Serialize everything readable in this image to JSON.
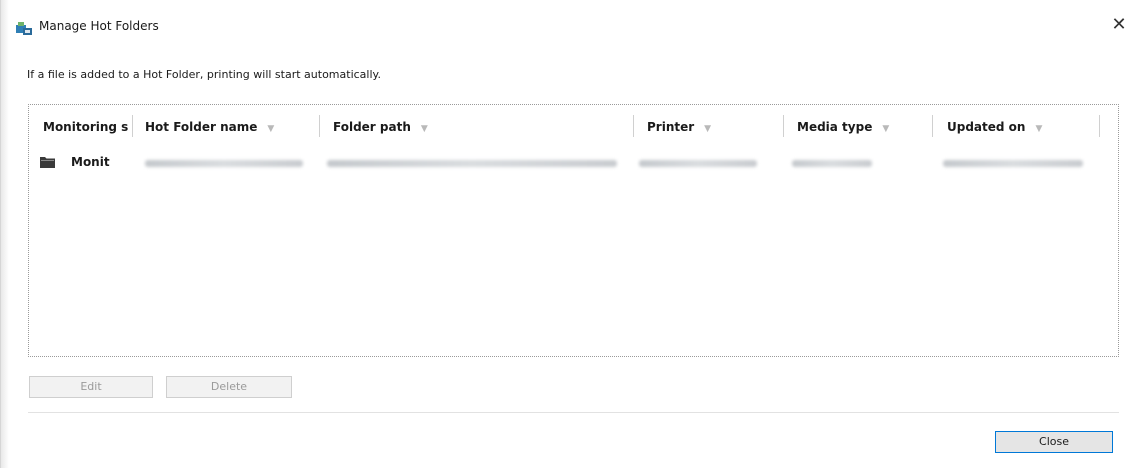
{
  "window": {
    "title": "Manage Hot Folders",
    "close_glyph": "✕"
  },
  "info_text": "If a file is added to a Hot Folder, printing will start automatically.",
  "table": {
    "columns": [
      {
        "label": "Monitoring s"
      },
      {
        "label": "Hot Folder name"
      },
      {
        "label": "Folder path"
      },
      {
        "label": "Printer"
      },
      {
        "label": "Media type"
      },
      {
        "label": "Updated on"
      }
    ],
    "sort_glyph": "▼",
    "rows": [
      {
        "status": "Monit",
        "icon": "folder-icon"
      }
    ]
  },
  "buttons": {
    "edit": "Edit",
    "delete": "Delete",
    "close": "Close"
  },
  "colors": {
    "accent": "#0078d7",
    "disabled_text": "#9a9a9a"
  }
}
